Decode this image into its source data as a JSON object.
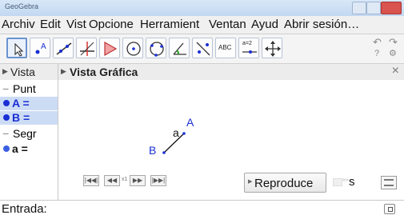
{
  "window": {
    "title": "GeoGebra"
  },
  "menu": [
    "Archiv",
    "Edit",
    "Vist",
    "Opcione",
    "Herramient",
    "Ventan",
    "Ayud",
    "Abrir sesión…"
  ],
  "toolbar": {
    "tools": [
      "move-tool",
      "point-tool",
      "line-tool",
      "perpendicular-tool",
      "polygon-tool",
      "circle-tool",
      "circle-three-points-tool",
      "angle-tool",
      "reflect-tool",
      "text-tool",
      "slider-tool",
      "move-graphics-tool"
    ],
    "text_tool_label": "ABC",
    "slider_tool_label": "a=2",
    "undo_symbol": "↶",
    "redo_symbol": "↷",
    "help_symbol": "?",
    "settings_symbol": "⚙"
  },
  "algebra_view": {
    "header": "Vista",
    "groups": [
      {
        "title": "Punt",
        "items": [
          {
            "label": "A ="
          },
          {
            "label": "B ="
          }
        ]
      },
      {
        "title": "Segr",
        "items": [
          {
            "label": "a ="
          }
        ]
      }
    ],
    "collapse_symbol": "−"
  },
  "graphics_view": {
    "header": "Vista Gráfica",
    "close_symbol": "×",
    "points": [
      {
        "name": "A"
      },
      {
        "name": "B"
      }
    ],
    "segment_label": "a"
  },
  "animation": {
    "play_button_label": "Reproduce",
    "speed_label": "s",
    "speed_value": "x1"
  },
  "input_bar": {
    "label": "Entrada:",
    "value": ""
  },
  "colors": {
    "point_blue": "#1a2fd4",
    "selection_bg": "#cddcf5",
    "header_bg": "#ececec"
  }
}
